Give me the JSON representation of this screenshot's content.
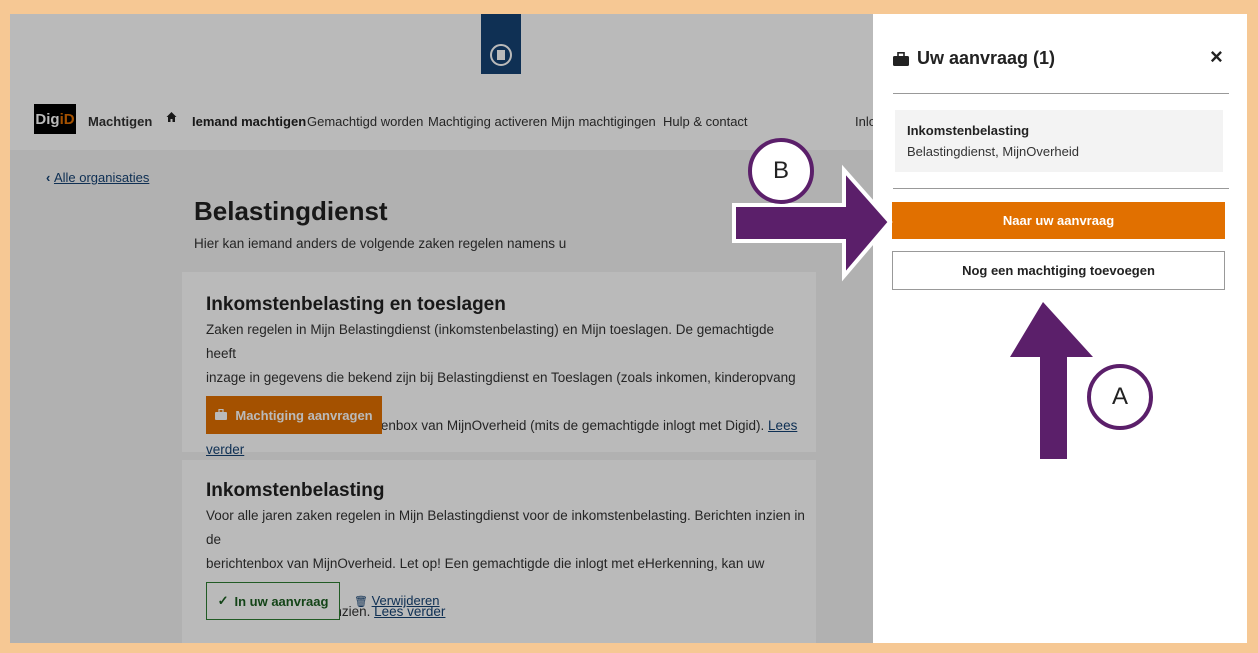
{
  "header": {
    "logo_alt": "Rijksoverheid"
  },
  "nav": {
    "digid_part1": "Dig",
    "digid_part2": "iD",
    "brand": "Machtigen",
    "items": [
      "Iemand machtigen",
      "Gemachtigd worden",
      "Machtiging activeren",
      "Mijn machtigingen",
      "Hulp & contact",
      "Inlo"
    ]
  },
  "back_link": "Alle organisaties",
  "page": {
    "title": "Belastingdienst",
    "subtitle": "Hier kan iemand anders de volgende zaken regelen namens u"
  },
  "cards": [
    {
      "title": "Inkomstenbelasting en toeslagen",
      "lines": [
        "Zaken regelen in Mijn Belastingdienst (inkomstenbelasting) en Mijn toeslagen. De gemachtigde heeft",
        "inzage in gegevens die bekend zijn bij Belastingdienst en Toeslagen (zoals inkomen, kinderopvang en huur).",
        "Berichten inzien in de Berichtenbox van MijnOverheid (mits de gemachtigde inlogt met Digid)."
      ],
      "read_more": "Lees verder",
      "button": "Machtiging aanvragen"
    },
    {
      "title": "Inkomstenbelasting",
      "lines": [
        "Voor alle jaren zaken regelen in Mijn Belastingdienst voor de inkomstenbelasting. Berichten inzien in de",
        "berichtenbox van MijnOverheid. Let op! Een gemachtigde die inlogt met eHerkenning, kan uw berichten in",
        "de berichtenbox niet inzien."
      ],
      "read_more": "Lees verder",
      "status_button": "In uw aanvraag",
      "remove_link": "Verwijderen"
    }
  ],
  "panel": {
    "title": "Uw aanvraag (1)",
    "close": "×",
    "item_title": "Inkomstenbelasting",
    "item_sub": "Belastingdienst, MijnOverheid",
    "primary_button": "Naar uw aanvraag",
    "secondary_button": "Nog een machtiging toevoegen"
  },
  "annotations": {
    "a": "A",
    "b": "B"
  },
  "colors": {
    "orange": "#e17000",
    "purple": "#5b1f6a",
    "frame": "#f6c894",
    "navy": "#154273"
  }
}
